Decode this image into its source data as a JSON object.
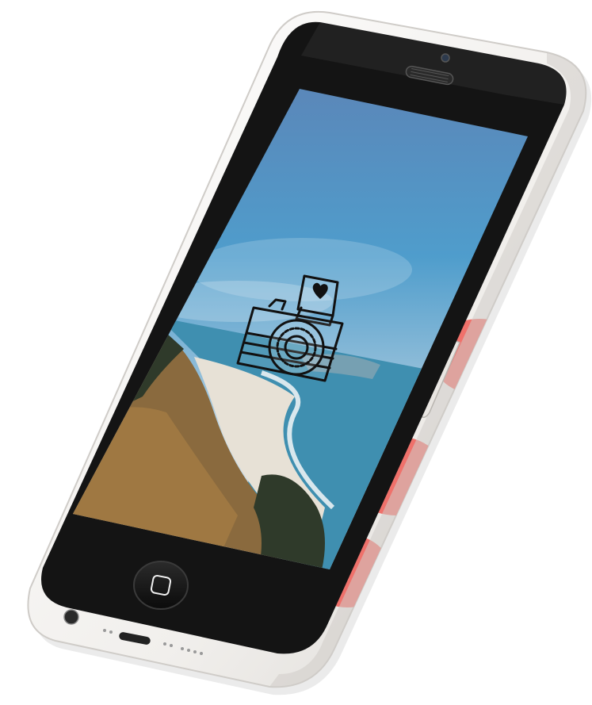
{
  "scene": {
    "subject": "smartphone",
    "colors": {
      "background": "#ffffff",
      "case_body": "#f3f1ee",
      "case_shadow": "#cfccc8",
      "bezel": "#141414",
      "case_accent": "#ef6a64",
      "sky_top": "#5b86b8",
      "sky_mid": "#4f9dcc",
      "sky_horizon": "#c9dbe6",
      "sea": "#3f8fb0",
      "sand": "#e7e1d6",
      "hill": "#8a6a3e",
      "trees": "#2f3a2a",
      "doodle_stroke": "#111111"
    },
    "icons": [
      "camera-doodle-icon",
      "heart-icon",
      "home-square-icon",
      "speaker-grille-icon",
      "front-camera-icon"
    ]
  }
}
